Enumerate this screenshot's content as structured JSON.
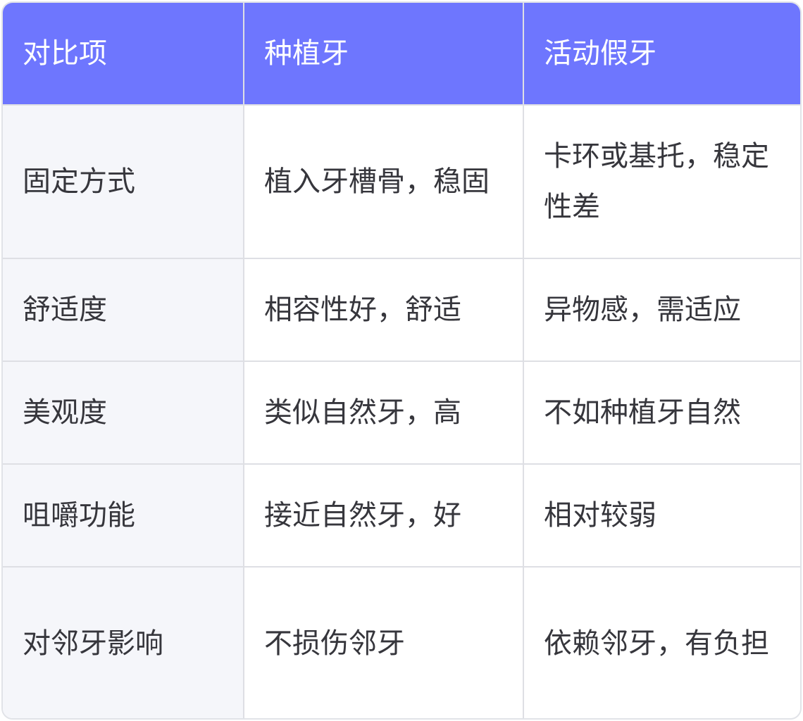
{
  "header": {
    "col1": "对比项",
    "col2": "种植牙",
    "col3": "活动假牙"
  },
  "rows": [
    {
      "item": "固定方式",
      "implant": "植入牙槽骨，稳固",
      "denture": "卡环或基托，稳定性差"
    },
    {
      "item": "舒适度",
      "implant": "相容性好，舒适",
      "denture": "异物感，需适应"
    },
    {
      "item": "美观度",
      "implant": "类似自然牙，高",
      "denture": "不如种植牙自然"
    },
    {
      "item": "咀嚼功能",
      "implant": "接近自然牙，好",
      "denture": "相对较弱"
    },
    {
      "item": "对邻牙影响",
      "implant": "不损伤邻牙",
      "denture": "依赖邻牙，有负担"
    }
  ],
  "colors": {
    "header_bg": "#6e76fe",
    "label_bg": "#f5f6fa",
    "text": "#36363c",
    "border": "#dedfe4"
  }
}
